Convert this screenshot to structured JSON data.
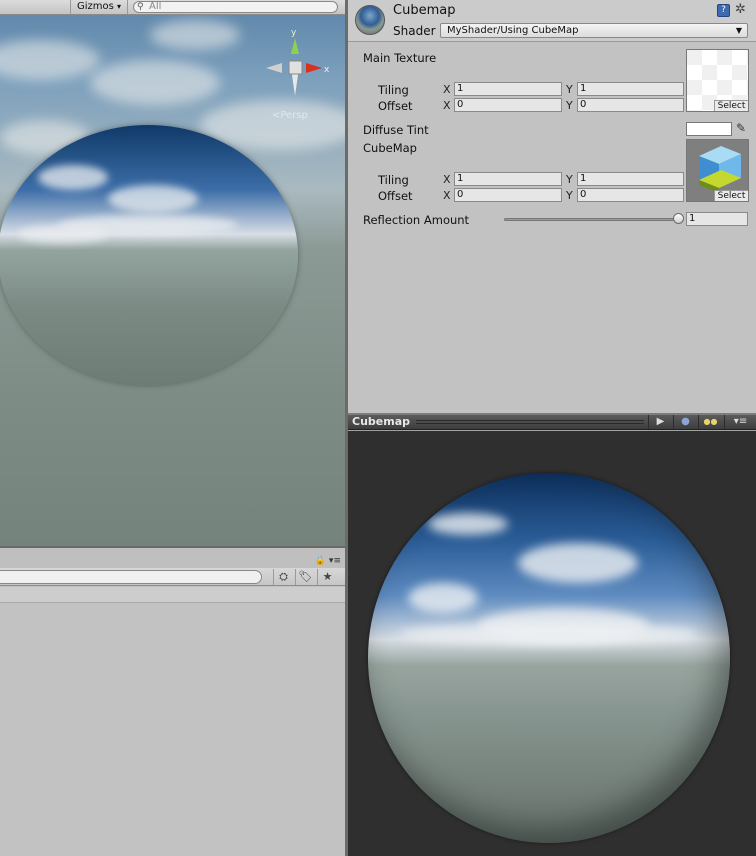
{
  "scene": {
    "gizmos_label": "Gizmos",
    "gizmos_arrow": "▾",
    "search_placeholder": "All",
    "persp_label": "<Persp",
    "axis_y": "y",
    "axis_x": "x"
  },
  "project": {
    "menu_icons": "🔒 ▾≡",
    "toolbar_icons": [
      "⛭",
      "🏷",
      "★"
    ]
  },
  "inspector": {
    "material_name": "Cubemap",
    "shader_label": "Shader",
    "shader_value": "MyShader/Using CubeMap",
    "help_glyph": "?",
    "gear_glyph": "✲",
    "properties": {
      "main_texture": {
        "label": "Main Texture",
        "tiling_label": "Tiling",
        "offset_label": "Offset",
        "tiling_x": "1",
        "tiling_y": "1",
        "offset_x": "0",
        "offset_y": "0",
        "select_label": "Select"
      },
      "diffuse_tint": {
        "label": "Diffuse Tint",
        "color": "#ffffff"
      },
      "cubemap": {
        "label": "CubeMap",
        "tiling_label": "Tiling",
        "offset_label": "Offset",
        "tiling_x": "1",
        "tiling_y": "1",
        "offset_x": "0",
        "offset_y": "0",
        "select_label": "Select"
      },
      "reflection_amount": {
        "label": "Reflection Amount",
        "value": "1",
        "fraction": 1.0
      }
    },
    "x_label": "X",
    "y_label": "Y"
  },
  "preview": {
    "title": "Cubemap",
    "play_glyph": "▶",
    "sphere_glyph": "●",
    "lights_glyph": "●●",
    "menu_glyph": "▾≡"
  },
  "colors": {
    "panel_bg": "#c2c2c2",
    "preview_bg": "#2f2f2f",
    "accent_help": "#3d6ab0",
    "gizmo_y": "#8fd14f",
    "gizmo_x": "#d8321e"
  }
}
